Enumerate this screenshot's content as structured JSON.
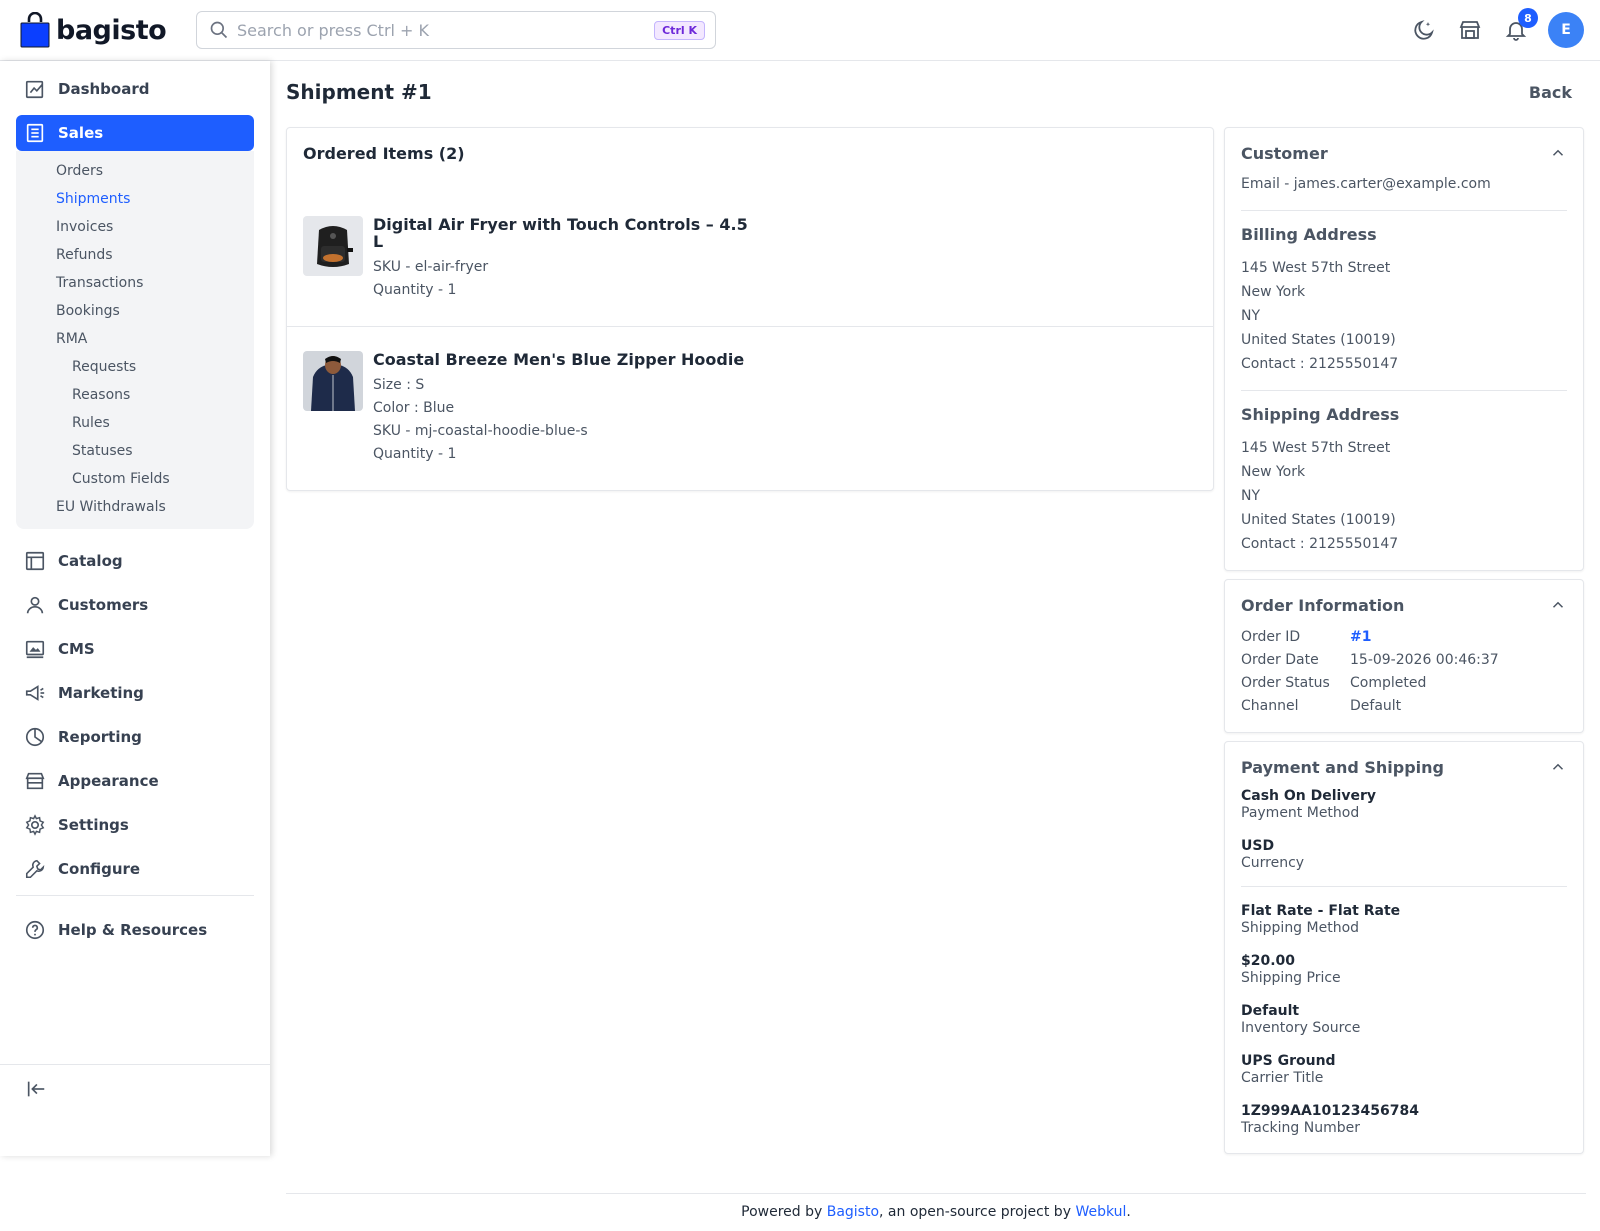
{
  "brand": {
    "name": "bagisto"
  },
  "header": {
    "search_placeholder": "Search or press Ctrl + K",
    "shortcut": "Ctrl K",
    "notification_count": "8",
    "avatar_initial": "E"
  },
  "sidebar": {
    "items": [
      {
        "label": "Dashboard",
        "icon": "dashboard-icon"
      },
      {
        "label": "Sales",
        "icon": "sales-icon"
      },
      {
        "label": "Catalog",
        "icon": "catalog-icon"
      },
      {
        "label": "Customers",
        "icon": "customers-icon"
      },
      {
        "label": "CMS",
        "icon": "cms-icon"
      },
      {
        "label": "Marketing",
        "icon": "marketing-icon"
      },
      {
        "label": "Reporting",
        "icon": "reporting-icon"
      },
      {
        "label": "Appearance",
        "icon": "appearance-icon"
      },
      {
        "label": "Settings",
        "icon": "settings-icon"
      },
      {
        "label": "Configure",
        "icon": "configure-icon"
      },
      {
        "label": "Help & Resources",
        "icon": "help-icon"
      }
    ],
    "sales_submenu": [
      "Orders",
      "Shipments",
      "Invoices",
      "Refunds",
      "Transactions",
      "Bookings",
      "RMA"
    ],
    "rma_submenu": [
      "Requests",
      "Reasons",
      "Rules",
      "Statuses",
      "Custom Fields"
    ],
    "sales_submenu_tail": "EU Withdrawals"
  },
  "page": {
    "title": "Shipment #1",
    "back": "Back"
  },
  "ordered_items": {
    "title": "Ordered Items (2)",
    "items": [
      {
        "name": "Digital Air Fryer with Touch Controls – 4.5 L",
        "lines": [
          "SKU - el-air-fryer",
          "Quantity - 1"
        ]
      },
      {
        "name": "Coastal Breeze Men's Blue Zipper Hoodie",
        "lines": [
          "Size : S",
          "Color : Blue",
          "SKU - mj-coastal-hoodie-blue-s",
          "Quantity - 1"
        ]
      }
    ]
  },
  "customer": {
    "title": "Customer",
    "email": "Email - james.carter@example.com",
    "billing_title": "Billing Address",
    "billing": [
      "145 West 57th Street",
      "New York",
      "NY",
      "United States (10019)",
      "Contact : 2125550147"
    ],
    "shipping_title": "Shipping Address",
    "shipping": [
      "145 West 57th Street",
      "New York",
      "NY",
      "United States (10019)",
      "Contact : 2125550147"
    ]
  },
  "order_info": {
    "title": "Order Information",
    "rows": [
      {
        "k": "Order ID",
        "v": "#1"
      },
      {
        "k": "Order Date",
        "v": "15-09-2026 00:46:37"
      },
      {
        "k": "Order Status",
        "v": "Completed"
      },
      {
        "k": "Channel",
        "v": "Default"
      }
    ]
  },
  "payment_shipping": {
    "title": "Payment and Shipping",
    "payment": [
      {
        "v": "Cash On Delivery",
        "l": "Payment Method"
      },
      {
        "v": "USD",
        "l": "Currency"
      }
    ],
    "shipping": [
      {
        "v": "Flat Rate - Flat Rate",
        "l": "Shipping Method"
      },
      {
        "v": "$20.00",
        "l": "Shipping Price"
      },
      {
        "v": "Default",
        "l": "Inventory Source"
      },
      {
        "v": "UPS Ground",
        "l": "Carrier Title"
      },
      {
        "v": "1Z999AA10123456784",
        "l": "Tracking Number"
      }
    ]
  },
  "footer": {
    "prefix": "Powered by ",
    "link1": "Bagisto",
    "middle": ", an open-source project by ",
    "link2": "Webkul",
    "suffix": "."
  },
  "colors": {
    "accent": "#1e5eff",
    "avatar": "#3b82f6"
  }
}
